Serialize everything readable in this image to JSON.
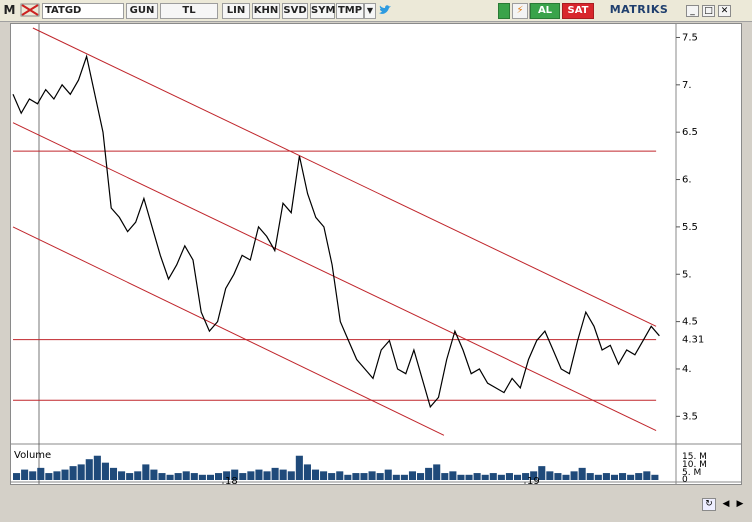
{
  "toolbar": {
    "m_label": "M",
    "symbol": "TATGD",
    "period": "GUN",
    "currency": "TL",
    "scale": "LIN",
    "khn": "KHN",
    "svd": "SVD",
    "sym": "SYM",
    "tmp": "TMP",
    "buy": "AL",
    "sell": "SAT",
    "brand": "MATRIKS"
  },
  "colors": {
    "price_line": "#000000",
    "trend_lines": "#c0262c",
    "volume_bars": "#1f4a7a",
    "buy": "#3aa34a",
    "sell": "#d8262c"
  },
  "chart_data": {
    "type": "line",
    "price_axis": {
      "ticks": [
        "7.5",
        "7.",
        "6.5",
        "6.",
        "5.5",
        "5.",
        "4.5",
        "4.",
        "3.5"
      ],
      "last": "4.31",
      "ylim": [
        3.25,
        7.6
      ]
    },
    "volume_axis": {
      "label": "Volume",
      "ticks": [
        "15. M",
        "10. M",
        "5. M",
        "0"
      ]
    },
    "x_axis": {
      "ticks": [
        "18",
        "19"
      ]
    },
    "series": [
      {
        "values": [
          6.9,
          6.7,
          6.85,
          6.8,
          6.95,
          6.85,
          7.0,
          6.9,
          7.05,
          7.3,
          6.9,
          6.5,
          5.7,
          5.6,
          5.45,
          5.55,
          5.8,
          5.5,
          5.2,
          4.95,
          5.1,
          5.3,
          5.15,
          4.6,
          4.4,
          4.5,
          4.85,
          5.0,
          5.2,
          5.15,
          5.5,
          5.4,
          5.25,
          5.75,
          5.65,
          6.25,
          5.85,
          5.6,
          5.5,
          5.1,
          4.5,
          4.3,
          4.1,
          4.0,
          3.9,
          4.2,
          4.3,
          4.0,
          3.95,
          4.2,
          3.9,
          3.6,
          3.7,
          4.1,
          4.4,
          4.2,
          3.95,
          4.0,
          3.85,
          3.8,
          3.75,
          3.9,
          3.8,
          4.1,
          4.3,
          4.4,
          4.2,
          4.0,
          3.95,
          4.3,
          4.6,
          4.45,
          4.2,
          4.25,
          4.05,
          4.2,
          4.15,
          4.3,
          4.45,
          4.35
        ]
      },
      {
        "values": [
          4,
          6,
          5,
          7,
          4,
          5,
          6,
          8,
          9,
          12,
          14,
          10,
          7,
          5,
          4,
          5,
          9,
          6,
          4,
          3,
          4,
          5,
          4,
          3,
          3,
          4,
          5,
          6,
          4,
          5,
          6,
          5,
          7,
          6,
          5,
          14,
          9,
          6,
          5,
          4,
          5,
          3,
          4,
          4,
          5,
          4,
          6,
          3,
          3,
          5,
          4,
          7,
          9,
          4,
          5,
          3,
          3,
          4,
          3,
          4,
          3,
          4,
          3,
          4,
          5,
          8,
          5,
          4,
          3,
          5,
          7,
          4,
          3,
          4,
          3,
          4,
          3,
          4,
          5,
          3
        ]
      }
    ],
    "trend_lines": [
      {
        "from": [
          0.03,
          7.6
        ],
        "to": [
          0.97,
          4.45
        ]
      },
      {
        "from": [
          0.0,
          6.6
        ],
        "to": [
          0.97,
          3.35
        ]
      },
      {
        "from": [
          0.0,
          5.5
        ],
        "to": [
          0.65,
          3.3
        ]
      },
      {
        "from": [
          0.0,
          6.3
        ],
        "to": [
          0.97,
          6.3
        ]
      },
      {
        "from": [
          0.0,
          4.31
        ],
        "to": [
          0.97,
          4.31
        ]
      },
      {
        "from": [
          0.0,
          3.67
        ],
        "to": [
          0.97,
          3.67
        ]
      }
    ]
  }
}
